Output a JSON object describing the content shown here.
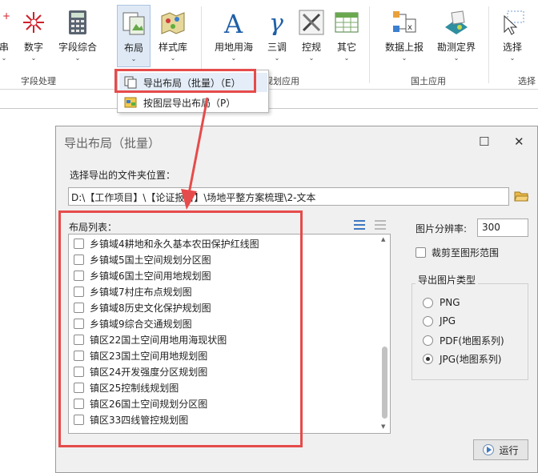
{
  "ribbon": {
    "buttons": [
      {
        "label": "串",
        "icon": "sparkle-icon"
      },
      {
        "label": "数字",
        "icon": "sparkle-number-icon"
      },
      {
        "label": "字段综合",
        "icon": "calculator-icon"
      },
      {
        "label": "布局",
        "icon": "layout-icon"
      },
      {
        "label": "样式库",
        "icon": "style-library-icon"
      },
      {
        "label": "用地用海",
        "icon": "letter-a-icon"
      },
      {
        "label": "三调",
        "icon": "gamma-icon"
      },
      {
        "label": "控规",
        "icon": "tools-icon"
      },
      {
        "label": "其它",
        "icon": "table-icon"
      },
      {
        "label": "数据上报",
        "icon": "data-report-icon"
      },
      {
        "label": "勘测定界",
        "icon": "survey-icon"
      },
      {
        "label": "选择",
        "icon": "select-cursor-icon"
      }
    ],
    "groups": [
      "字段处理",
      "规划应用",
      "国土应用",
      "选择"
    ]
  },
  "menu": {
    "items": [
      {
        "label": "导出布局（批量）（E）",
        "icon": "layout-copy-icon"
      },
      {
        "label": "按图层导出布局（P）",
        "icon": "layer-export-icon"
      }
    ]
  },
  "dialog": {
    "title": "导出布局（批量）",
    "path_label": "选择导出的文件夹位置：",
    "path_value": "D:\\【工作项目】\\【论证报告】\\场地平整方案梳理\\2-文本",
    "list_label": "布局列表：",
    "list_items": [
      "乡镇域4耕地和永久基本农田保护红线图",
      "乡镇域5国土空间规划分区图",
      "乡镇域6国土空间用地规划图",
      "乡镇域7村庄布点规划图",
      "乡镇域8历史文化保护规划图",
      "乡镇域9综合交通规划图",
      "镇区22国土空间用地用海现状图",
      "镇区23国土空间用地规划图",
      "镇区24开发强度分区规划图",
      "镇区25控制线规划图",
      "镇区26国土空间规划分区图",
      "镇区33四线管控规划图"
    ],
    "resolution_label": "图片分辨率:",
    "resolution_value": "300",
    "crop_label": "裁剪至图形范围",
    "type_legend": "导出图片类型",
    "types": [
      "PNG",
      "JPG",
      "PDF(地图系列)",
      "JPG(地图系列)"
    ],
    "selected_type": "JPG(地图系列)",
    "run_label": "运行"
  },
  "colors": {
    "highlight_red": "#e64b4b",
    "accent_blue": "#3f79c1",
    "dialog_bg": "#f0f0f0"
  }
}
